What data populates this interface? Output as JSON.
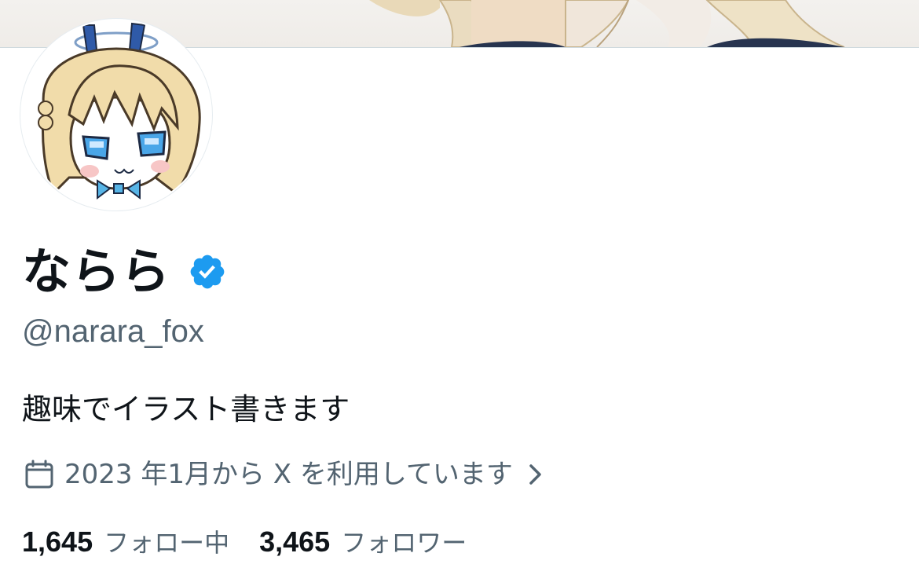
{
  "profile": {
    "display_name": "ならら",
    "handle": "@narara_fox",
    "bio": "趣味でイラスト書きます",
    "joined": "2023 年1月から X を利用しています",
    "verified": true
  },
  "stats": {
    "following_count": "1,645",
    "following_label": "フォロー中",
    "followers_count": "3,465",
    "followers_label": "フォロワー"
  },
  "icons": {
    "verified": "verified-badge-icon",
    "calendar": "calendar-icon",
    "chevron": "chevron-right-icon"
  },
  "colors": {
    "text_primary": "#0f1419",
    "text_secondary": "#536471",
    "verified_blue": "#1d9bf0",
    "divider": "#cfd9de"
  }
}
